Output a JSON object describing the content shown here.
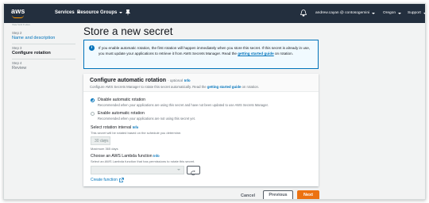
{
  "nav": {
    "logo_text": "aws",
    "services_label": "Services",
    "resource_groups_label": "Resource Groups",
    "user_label": "andrew.cayan @ contosogemini",
    "region_label": "Oregon",
    "support_label": "Support"
  },
  "sidebar": {
    "cut_label": "Secret type",
    "steps": [
      {
        "step_label": "Step 2",
        "name": "Name and description"
      },
      {
        "step_label": "Step 3",
        "name": "Configure rotation"
      },
      {
        "step_label": "Step 4",
        "name": "Review"
      }
    ]
  },
  "main": {
    "title": "Store a new secret",
    "info_text_1": "If you enable automatic rotation, the first rotation will happen immediately when you store this secret. If this secret is already in use, you must update your applications to retrieve it from AWS Secrets Manager. Read the ",
    "info_link": "getting started guide",
    "info_text_2": " on rotation.",
    "panel": {
      "title": "Configure automatic rotation",
      "optional": "- optional",
      "info": "Info",
      "desc_1": "Configure AWS Secrets Manager to rotate this secret automatically. Read the ",
      "desc_link": "getting started guide",
      "desc_2": " on rotation.",
      "options": [
        {
          "label": "Disable automatic rotation",
          "desc": "Recommended when your applications are using this secret and have not been updated to use AWS Secrets Manager.",
          "selected": true
        },
        {
          "label": "Enable automatic rotation",
          "desc": "Recommended when your applications are not using this secret yet.",
          "selected": false
        }
      ],
      "interval_label": "Select rotation interval",
      "interval_info": "Info",
      "interval_desc": "This secret will be rotated based on the schedule you determine.",
      "interval_value": "30 days",
      "interval_max": "Maximum 365 days",
      "lambda_label": "Choose an AWS Lambda function",
      "lambda_info": "Info",
      "lambda_desc": "Select an AWS Lambda function that has permissions to rotate this secret.",
      "lambda_value": "",
      "create_function": "Create function"
    }
  },
  "footer": {
    "cancel": "Cancel",
    "previous": "Previous",
    "next": "Next"
  },
  "colors": {
    "nav_bg": "#232f3e",
    "accent_orange": "#ec7211",
    "link_blue": "#0073bb"
  }
}
